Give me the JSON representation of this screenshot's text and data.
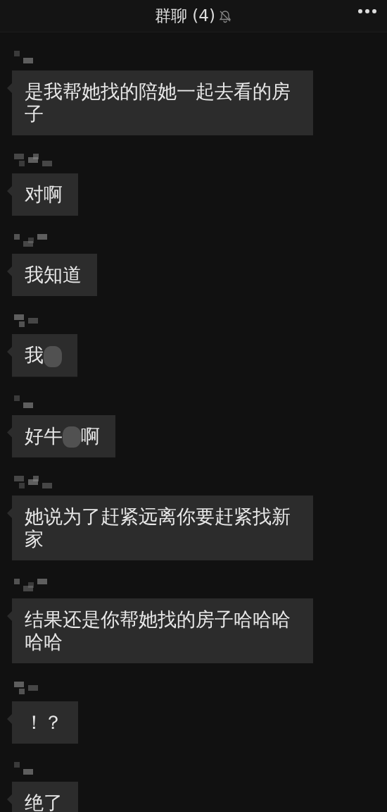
{
  "header": {
    "title": "群聊 (4)",
    "muted": true
  },
  "messages": [
    {
      "text": "是我帮她找的陪她一起去看的房子"
    },
    {
      "text": "对啊"
    },
    {
      "text": "我知道"
    },
    {
      "text": "我",
      "smudge": true
    },
    {
      "text": "好牛",
      "smudge": true,
      "text_after": "啊"
    },
    {
      "text": "她说为了赶紧远离你要赶紧找新家"
    },
    {
      "text": "结果还是你帮她找的房子哈哈哈哈哈"
    },
    {
      "text": "！？"
    },
    {
      "text": "绝了"
    }
  ]
}
